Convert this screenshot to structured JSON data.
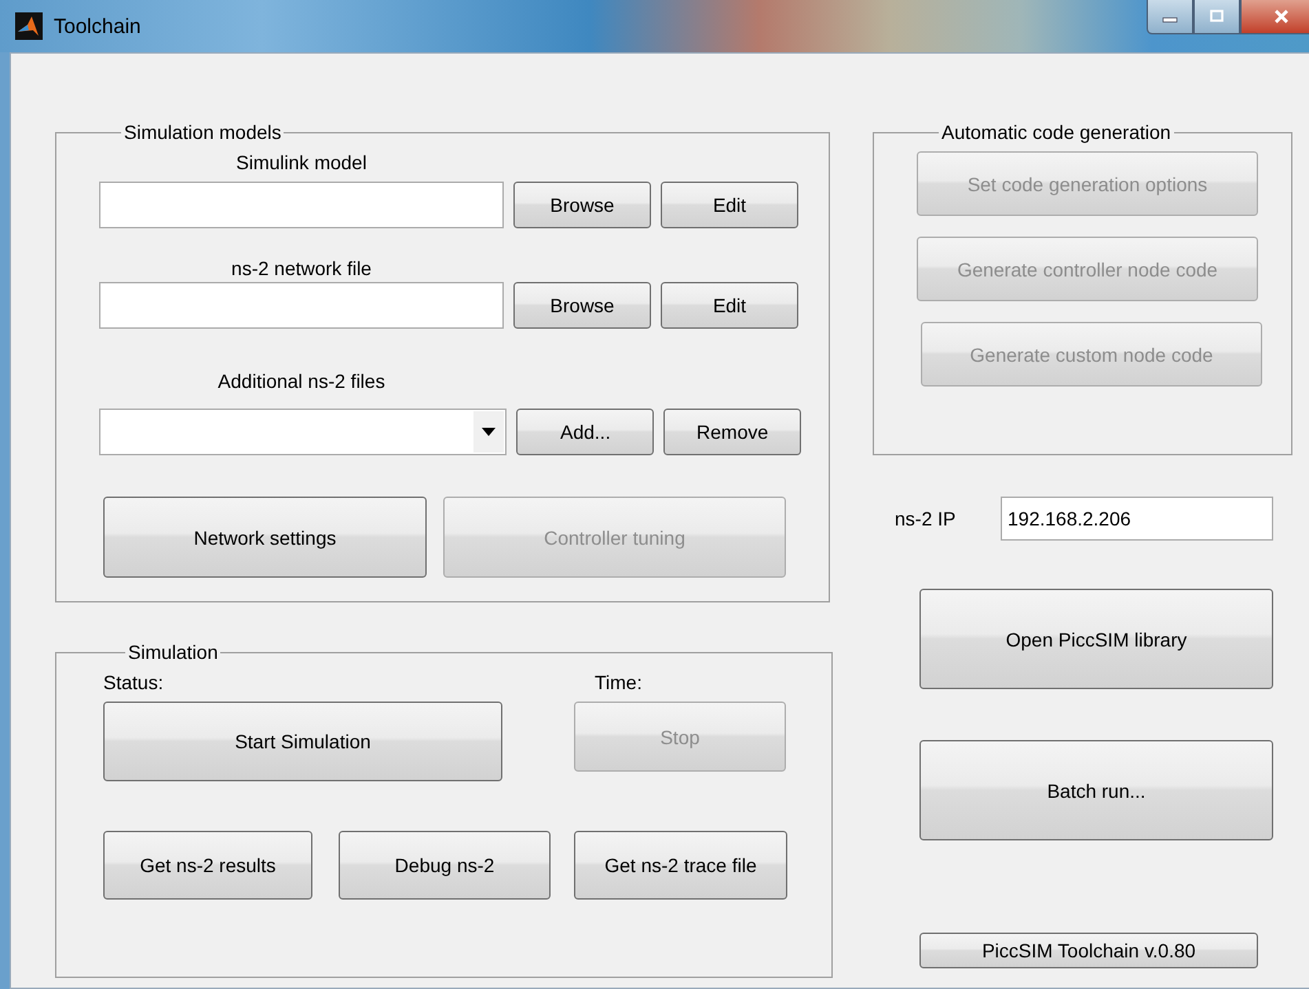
{
  "window": {
    "title": "Toolchain"
  },
  "simulation_models": {
    "title": "Simulation models",
    "rows": [
      {
        "kind": "text",
        "label": "Simulink model",
        "buttons": [
          {
            "label": "Browse",
            "disabled": false
          },
          {
            "label": "Edit",
            "disabled": false
          }
        ]
      },
      {
        "kind": "text",
        "label": "ns-2 network file",
        "buttons": [
          {
            "label": "Browse",
            "disabled": false
          },
          {
            "label": "Edit",
            "disabled": false
          }
        ]
      },
      {
        "kind": "dropdown",
        "label": "Additional ns-2 files",
        "buttons": [
          {
            "label": "Add...",
            "disabled": false
          },
          {
            "label": "Remove",
            "disabled": false
          }
        ]
      }
    ],
    "buttons": [
      {
        "label": "Network settings",
        "disabled": false
      },
      {
        "label": "Controller tuning",
        "disabled": true
      }
    ]
  },
  "simulation": {
    "title": "Simulation",
    "status_label": "Status:",
    "time_label": "Time:",
    "start_button": {
      "label": "Start Simulation",
      "disabled": false
    },
    "stop_button": {
      "label": "Stop",
      "disabled": true
    },
    "buttons": [
      {
        "label": "Get ns-2 results",
        "disabled": false
      },
      {
        "label": "Debug ns-2",
        "disabled": false
      },
      {
        "label": "Get ns-2 trace file",
        "disabled": false
      }
    ]
  },
  "code_generation": {
    "title": "Automatic code generation",
    "buttons": [
      {
        "label": "Set code generation options",
        "disabled": true
      },
      {
        "label": "Generate controller node code",
        "disabled": true
      },
      {
        "label": "Generate custom node code",
        "disabled": true
      }
    ]
  },
  "ip": {
    "label": "ns-2 IP",
    "value": "192.168.2.206"
  },
  "actions": [
    {
      "label": "Open PiccSIM library",
      "disabled": false
    },
    {
      "label": "Batch run...",
      "disabled": false
    }
  ],
  "version_button": {
    "label": "PiccSIM Toolchain v.0.80",
    "disabled": false
  }
}
